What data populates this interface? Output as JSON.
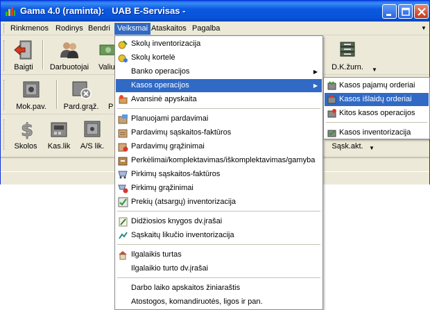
{
  "window": {
    "title": "Gama 4.0 (raminta):   UAB E-Servisas -"
  },
  "menubar": {
    "items": [
      "Rinkmenos",
      "Rodinys",
      "Bendri",
      "Veiksmai",
      "Ataskaitos",
      "Pagalba"
    ],
    "active": "Veiksmai"
  },
  "toolbar1": {
    "buttons": [
      {
        "label": "Baigti",
        "icon": "exit-door-icon"
      },
      {
        "label": "Darbuotojai",
        "icon": "people-icon"
      },
      {
        "label": "Valiu",
        "icon": "currency-icon"
      },
      {
        "label": "D.K.žurn.",
        "icon": "ledger-stack-icon"
      }
    ]
  },
  "toolbar2": {
    "buttons": [
      {
        "label": "Mok.pav.",
        "icon": "safe-icon"
      },
      {
        "label": "Pard.grąž.",
        "icon": "return-safe-icon"
      },
      {
        "label": "P",
        "icon": "partial-icon"
      }
    ]
  },
  "toolbar3": {
    "buttons": [
      {
        "label": "Skolos",
        "icon": "dollar-icon"
      },
      {
        "label": "Kas.lik",
        "icon": "cash-register-icon"
      },
      {
        "label": "A/S lik.",
        "icon": "safe-balance-icon"
      },
      {
        "label": "Sąsk.akt.",
        "icon": "invoice-icon"
      }
    ]
  },
  "veiksmai_menu": {
    "items": [
      {
        "label": "Skolų inventorizacija",
        "icon": "debt-inventory-icon"
      },
      {
        "label": "Skolų kortelė",
        "icon": "debt-card-icon"
      },
      {
        "label": "Banko operacijos",
        "icon": "",
        "submenu": true
      },
      {
        "label": "Kasos operacijos",
        "icon": "",
        "submenu": true
      },
      {
        "label": "Avansinė apyskaita",
        "icon": "advance-report-icon"
      },
      {
        "label": "Planuojami pardavimai",
        "icon": "planned-sales-icon"
      },
      {
        "label": "Pardavimų sąskaitos-faktūros",
        "icon": "sales-invoice-icon"
      },
      {
        "label": "Pardavimų grąžinimai",
        "icon": "sales-return-icon"
      },
      {
        "label": "Perkėlimai/komplektavimas/iškomplektavimas/gamyba",
        "icon": "transfer-icon"
      },
      {
        "label": "Pirkimų sąskaitos-faktūros",
        "icon": "purchase-invoice-icon"
      },
      {
        "label": "Pirkimų grąžinimai",
        "icon": "purchase-return-icon"
      },
      {
        "label": "Prekių (atsargų) inventorizacija",
        "icon": "stock-inventory-icon"
      },
      {
        "label": "Didžiosios knygos dv.įrašai",
        "icon": "ledger-entry-icon"
      },
      {
        "label": "Sąskaitų likučio inventorizacija",
        "icon": "account-balance-icon"
      },
      {
        "label": "Ilgalaikis turtas",
        "icon": "fixed-assets-icon"
      },
      {
        "label": "Ilgalaikio turto dv.įrašai",
        "icon": ""
      },
      {
        "label": "Darbo laiko apskaitos žiniaraštis",
        "icon": ""
      },
      {
        "label": "Atostogos, komandiruotės, ligos ir pan.",
        "icon": ""
      }
    ],
    "highlighted": "Kasos operacijos"
  },
  "kasos_submenu": {
    "items": [
      {
        "label": "Kasos pajamų orderiai",
        "icon": "cash-in-icon"
      },
      {
        "label": "Kasos išlaidų orderiai",
        "icon": "cash-out-icon"
      },
      {
        "label": "Kitos kasos operacijos",
        "icon": "cash-other-icon"
      },
      {
        "label": "Kasos inventorizacija",
        "icon": "cash-inventory-icon"
      }
    ],
    "highlighted": "Kasos išlaidų orderiai"
  },
  "colors": {
    "titlebar": "#0a59e1",
    "highlight": "#316ac5",
    "chrome": "#ece9d8"
  }
}
